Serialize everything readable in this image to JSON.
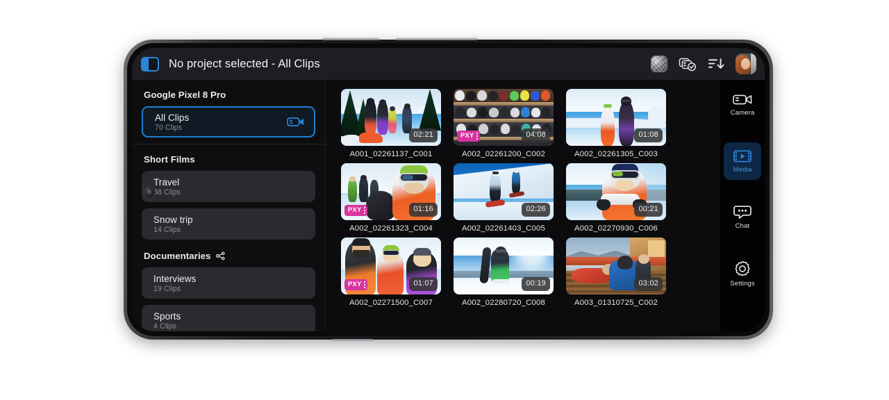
{
  "header": {
    "sidebar_toggle_icon": "sidebar-panel-icon",
    "title": "No project selected - All Clips",
    "actions": [
      {
        "name": "preview-thumbnail",
        "icon": "image-thumbnail-icon",
        "label": ""
      },
      {
        "name": "clips-selected",
        "icon": "clips-check-icon",
        "label": ""
      },
      {
        "name": "sort",
        "icon": "sort-descending-icon",
        "label": ""
      },
      {
        "name": "account-avatar",
        "icon": "avatar-icon",
        "label": ""
      }
    ]
  },
  "sidebar": {
    "device_section": {
      "title": "Google Pixel 8 Pro",
      "items": [
        {
          "name": "All Clips",
          "sub": "70 Clips",
          "selected": true,
          "badge_icon": "video-camera-icon"
        }
      ]
    },
    "sections": [
      {
        "title": "Short Films",
        "share_icon": null,
        "items": [
          {
            "name": "Travel",
            "sub": "38 Clips",
            "selected": false
          },
          {
            "name": "Snow trip",
            "sub": "14 Clips",
            "selected": false
          }
        ]
      },
      {
        "title": "Documentaries",
        "share_icon": "share-nodes-icon",
        "items": [
          {
            "name": "Interviews",
            "sub": "19 Clips",
            "selected": false
          },
          {
            "name": "Sports",
            "sub": "4 Clips",
            "selected": false
          }
        ]
      }
    ]
  },
  "clips": [
    {
      "label": "A001_02261137_C001",
      "duration": "02:21",
      "proxy": false,
      "proxy_label": "PXY",
      "scene": "group-snow-trees"
    },
    {
      "label": "A002_02261200_C002",
      "duration": "04:08",
      "proxy": true,
      "proxy_label": "PXY",
      "scene": "helmet-shelves"
    },
    {
      "label": "A002_02261305_C003",
      "duration": "01:08",
      "proxy": false,
      "proxy_label": "PXY",
      "scene": "two-skiers-slope"
    },
    {
      "label": "A002_02261323_C004",
      "duration": "01:16",
      "proxy": true,
      "proxy_label": "PXY",
      "scene": "goggles-portrait"
    },
    {
      "label": "A002_02261403_C005",
      "duration": "02:26",
      "proxy": false,
      "proxy_label": "PXY",
      "scene": "skier-ridge"
    },
    {
      "label": "A002_02270930_C006",
      "duration": "00:21",
      "proxy": false,
      "proxy_label": "PXY",
      "scene": "child-skier"
    },
    {
      "label": "A002_02271500_C007",
      "duration": "01:07",
      "proxy": true,
      "proxy_label": "PXY",
      "scene": "three-friends"
    },
    {
      "label": "A002_02280720_C008",
      "duration": "00:19",
      "proxy": false,
      "proxy_label": "PXY",
      "scene": "snowboarder-summit"
    },
    {
      "label": "A003_01310725_C002",
      "duration": "03:02",
      "proxy": false,
      "proxy_label": "PXY",
      "scene": "lodge-deck"
    }
  ],
  "nav_rail": [
    {
      "label": "Camera",
      "icon": "video-camera-icon",
      "active": false
    },
    {
      "label": "Media",
      "icon": "film-play-icon",
      "active": true
    },
    {
      "label": "Chat",
      "icon": "chat-bubble-icon",
      "active": false
    },
    {
      "label": "Settings",
      "icon": "gear-icon",
      "active": false
    }
  ],
  "colors": {
    "accent_blue": "#2b85d8",
    "active_blue": "#3a9bef",
    "proxy_magenta": "#d8349f",
    "panel_bg": "#0e0e10",
    "header_bg": "#1d1e21",
    "item_bg": "#2a2b2f"
  }
}
